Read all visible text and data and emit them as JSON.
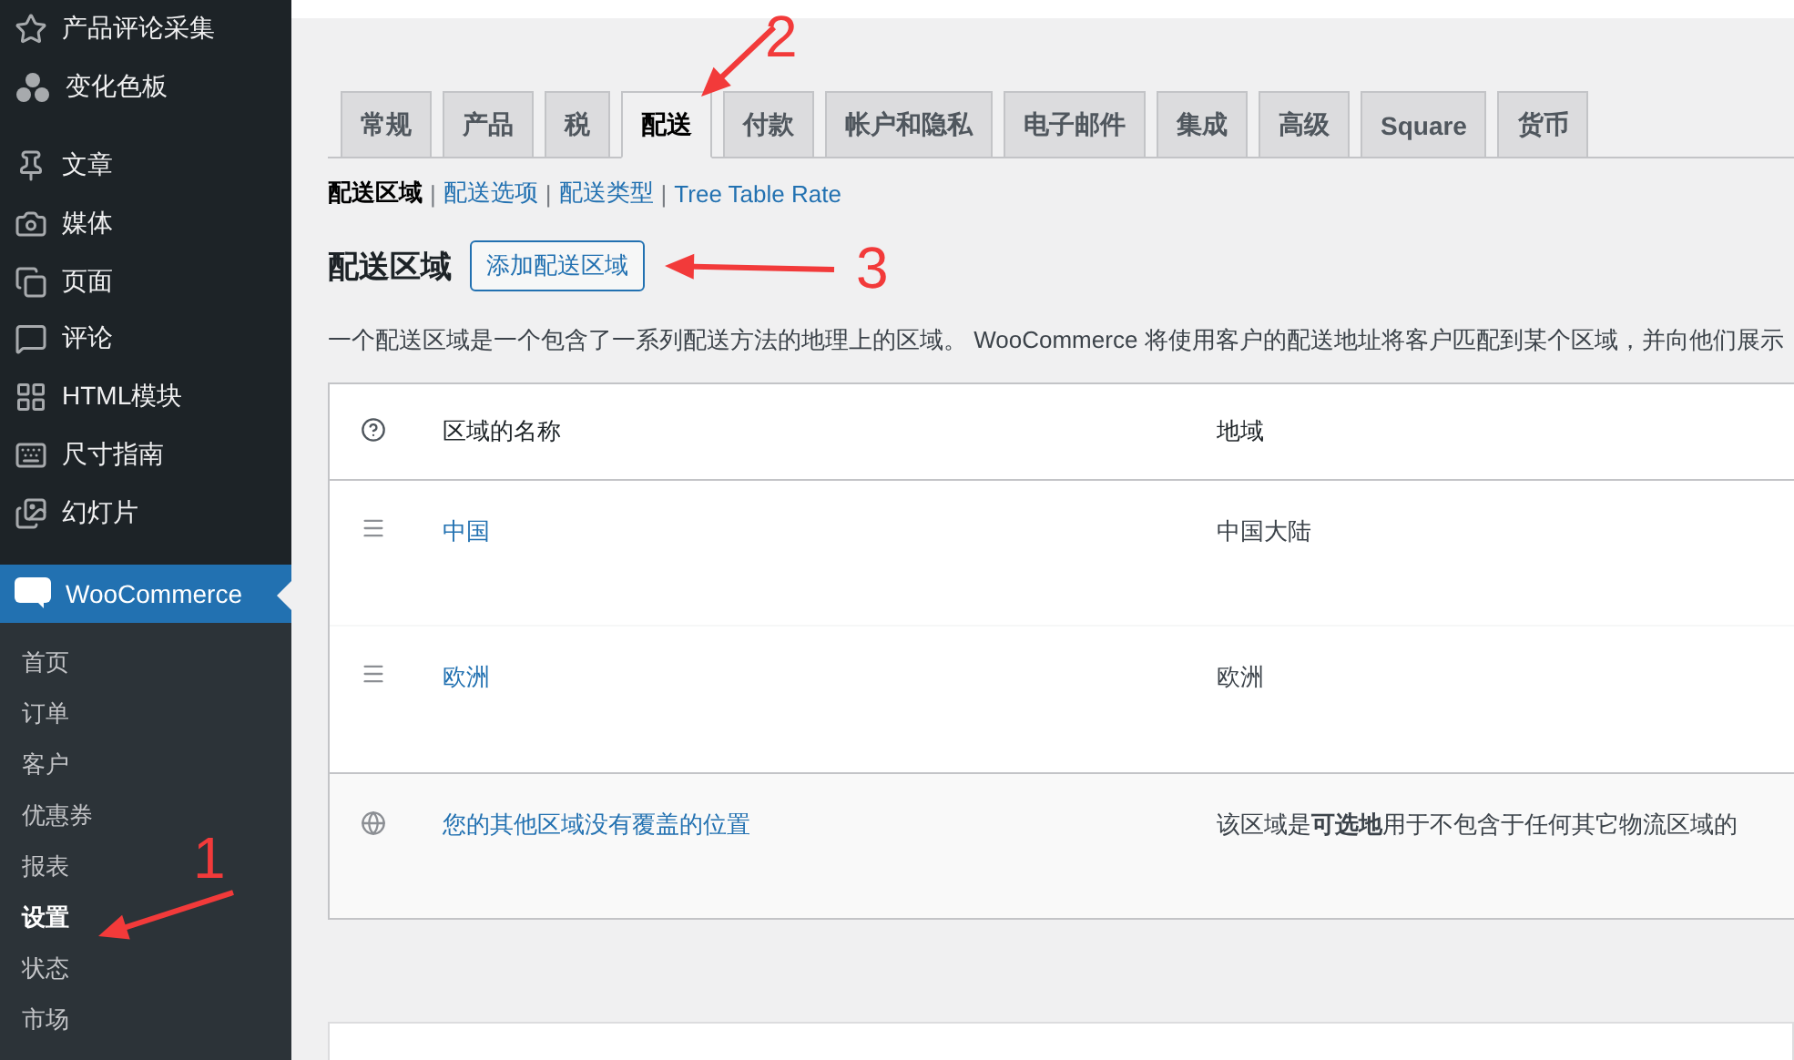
{
  "sidebar": {
    "items": [
      {
        "label": "产品评论采集"
      },
      {
        "label": "变化色板"
      },
      {
        "label": "文章"
      },
      {
        "label": "媒体"
      },
      {
        "label": "页面"
      },
      {
        "label": "评论"
      },
      {
        "label": "HTML模块"
      },
      {
        "label": "尺寸指南"
      },
      {
        "label": "幻灯片"
      }
    ],
    "plugin": {
      "label": "WooCommerce",
      "selected": true
    },
    "submenu": [
      {
        "label": "首页",
        "selected": false
      },
      {
        "label": "订单",
        "selected": false
      },
      {
        "label": "客户",
        "selected": false
      },
      {
        "label": "优惠券",
        "selected": false
      },
      {
        "label": "报表",
        "selected": false
      },
      {
        "label": "设置",
        "selected": true
      },
      {
        "label": "状态",
        "selected": false
      },
      {
        "label": "市场",
        "selected": false
      }
    ]
  },
  "tabs": [
    {
      "label": "常规",
      "selected": false
    },
    {
      "label": "产品",
      "selected": false
    },
    {
      "label": "税",
      "selected": false
    },
    {
      "label": "配送",
      "selected": true
    },
    {
      "label": "付款",
      "selected": false
    },
    {
      "label": "帐户和隐私",
      "selected": false
    },
    {
      "label": "电子邮件",
      "selected": false
    },
    {
      "label": "集成",
      "selected": false
    },
    {
      "label": "高级",
      "selected": false
    },
    {
      "label": "Square",
      "selected": false
    },
    {
      "label": "货币",
      "selected": false
    }
  ],
  "subnav": [
    {
      "label": "配送区域",
      "selected": true
    },
    {
      "separator": "|",
      "label": "配送选项",
      "selected": false
    },
    {
      "separator": "|",
      "label": "配送类型",
      "selected": false
    },
    {
      "separator": "|",
      "label": "Tree Table Rate",
      "selected": false
    }
  ],
  "heading": "配送区域",
  "add_button": "添加配送区域",
  "description": "一个配送区域是一个包含了一系列配送方法的地理上的区域。 WooCommerce 将使用客户的配送地址将客户匹配到某个区域，并向他们展示",
  "table": {
    "columns": [
      "区域的名称",
      "地域"
    ],
    "rows": [
      {
        "name": "中国",
        "region": "中国大陆"
      },
      {
        "name": "欧洲",
        "region": "欧洲"
      }
    ],
    "footer": {
      "name": "您的其他区域没有覆盖的位置",
      "region": "该区域是**可选地**用于不包含于任何其它物流区域的"
    }
  },
  "annotations": [
    {
      "label": "1"
    },
    {
      "label": "2"
    },
    {
      "label": "3"
    }
  ]
}
